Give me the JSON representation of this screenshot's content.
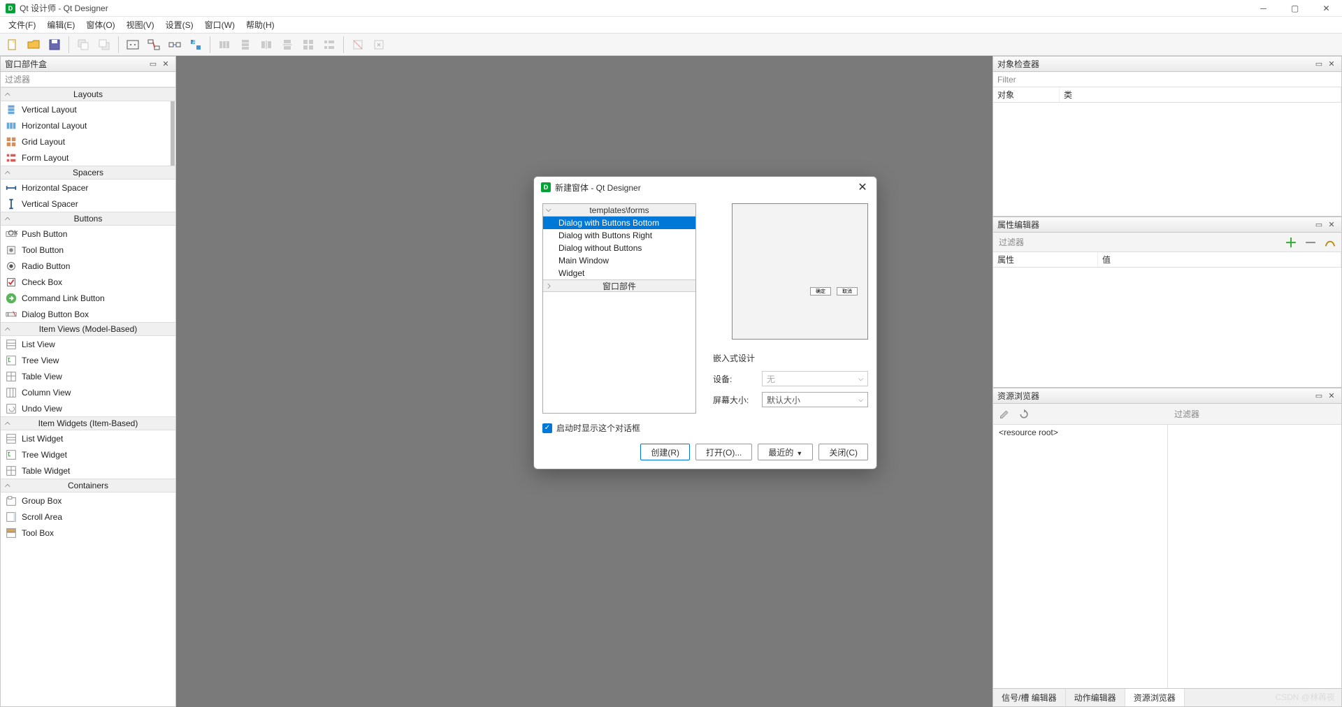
{
  "window": {
    "title": "Qt 设计师 - Qt Designer"
  },
  "menu": [
    "文件(F)",
    "编辑(E)",
    "窗体(O)",
    "视图(V)",
    "设置(S)",
    "窗口(W)",
    "帮助(H)"
  ],
  "widget_box": {
    "title": "窗口部件盒",
    "filter": "过滤器",
    "groups": [
      {
        "name": "Layouts",
        "items": [
          "Vertical Layout",
          "Horizontal Layout",
          "Grid Layout",
          "Form Layout"
        ]
      },
      {
        "name": "Spacers",
        "items": [
          "Horizontal Spacer",
          "Vertical Spacer"
        ]
      },
      {
        "name": "Buttons",
        "items": [
          "Push Button",
          "Tool Button",
          "Radio Button",
          "Check Box",
          "Command Link Button",
          "Dialog Button Box"
        ]
      },
      {
        "name": "Item Views (Model-Based)",
        "items": [
          "List View",
          "Tree View",
          "Table View",
          "Column View",
          "Undo View"
        ]
      },
      {
        "name": "Item Widgets (Item-Based)",
        "items": [
          "List Widget",
          "Tree Widget",
          "Table Widget"
        ]
      },
      {
        "name": "Containers",
        "items": [
          "Group Box",
          "Scroll Area",
          "Tool Box"
        ]
      }
    ]
  },
  "object_inspector": {
    "title": "对象检查器",
    "filter": "Filter",
    "col_object": "对象",
    "col_class": "类"
  },
  "property_editor": {
    "title": "属性编辑器",
    "filter": "过滤器",
    "col_prop": "属性",
    "col_value": "值"
  },
  "resource_browser": {
    "title": "资源浏览器",
    "filter": "过滤器",
    "root": "<resource root>",
    "tabs": [
      "信号/槽 编辑器",
      "动作编辑器",
      "资源浏览器"
    ]
  },
  "dialog": {
    "title": "新建窗体 - Qt Designer",
    "templates_header": "templates\\forms",
    "templates": [
      "Dialog with Buttons Bottom",
      "Dialog with Buttons Right",
      "Dialog without Buttons",
      "Main Window",
      "Widget"
    ],
    "widgets_header": "窗口部件",
    "embed_header": "嵌入式设计",
    "device_label": "设备:",
    "device_value": "无",
    "size_label": "屏幕大小:",
    "size_value": "默认大小",
    "show_on_start": "启动时显示这个对话框",
    "btn_create": "创建(R)",
    "btn_open": "打开(O)...",
    "btn_recent": "最近的",
    "btn_close": "关闭(C)",
    "preview_ok": "确定",
    "preview_cancel": "取消"
  },
  "watermark": "CSDN @林苒夜"
}
